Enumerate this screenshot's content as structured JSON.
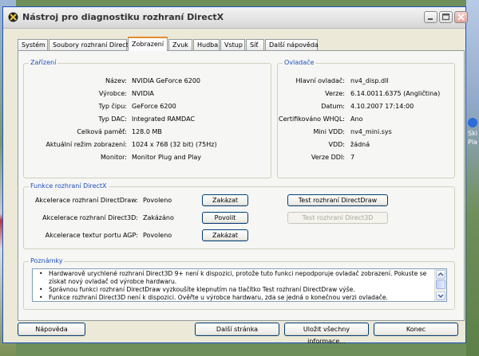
{
  "window": {
    "title": "Nástroj pro diagnostiku rozhraní DirectX"
  },
  "tabs": [
    {
      "label": "Systém"
    },
    {
      "label": "Soubory rozhraní DirectX"
    },
    {
      "label": "Zobrazení"
    },
    {
      "label": "Zvuk"
    },
    {
      "label": "Hudba"
    },
    {
      "label": "Vstup"
    },
    {
      "label": "Síť"
    },
    {
      "label": "Další nápověda"
    }
  ],
  "active_tab": "Zobrazení",
  "device": {
    "title": "Zařízení",
    "rows": [
      {
        "label": "Název:",
        "value": "NVIDIA GeForce 6200"
      },
      {
        "label": "Výrobce:",
        "value": "NVIDIA"
      },
      {
        "label": "Typ čipu:",
        "value": "GeForce 6200"
      },
      {
        "label": "Typ DAC:",
        "value": "Integrated RAMDAC"
      },
      {
        "label": "Celková paměť:",
        "value": "128.0 MB"
      },
      {
        "label": "Aktuální režim zobrazení:",
        "value": "1024 x 768 (32 bit) (75Hz)"
      },
      {
        "label": "Monitor:",
        "value": "Monitor Plug and Play"
      }
    ]
  },
  "drivers": {
    "title": "Ovladače",
    "rows": [
      {
        "label": "Hlavní ovladač:",
        "value": "nv4_disp.dll"
      },
      {
        "label": "Verze:",
        "value": "6.14.0011.6375 (Angličtina)"
      },
      {
        "label": "Datum:",
        "value": "4.10.2007 17:14:00"
      },
      {
        "label": "Certifikováno WHQL:",
        "value": "Ano"
      },
      {
        "label": "Mini VDD:",
        "value": "nv4_mini.sys"
      },
      {
        "label": "VDD:",
        "value": "žádná"
      },
      {
        "label": "Verze DDI:",
        "value": "7"
      }
    ]
  },
  "features": {
    "title": "Funkce rozhraní DirectX",
    "rows": [
      {
        "label": "Akcelerace rozhraní DirectDraw:",
        "status": "Povoleno",
        "toggle": "Zakázat",
        "test": "Test rozhraní DirectDraw",
        "test_enabled": true
      },
      {
        "label": "Akcelerace rozhraní Direct3D:",
        "status": "Zakázáno",
        "toggle": "Povolit",
        "test": "Test rozhraní Direct3D",
        "test_enabled": false
      },
      {
        "label": "Akcelerace textur portu AGP:",
        "status": "Povoleno",
        "toggle": "Zakázat"
      }
    ]
  },
  "notes": {
    "title": "Poznámky",
    "items": [
      "Hardwarově urychlené rozhraní Direct3D 9+ není k dispozici, protože tuto funkci nepodporuje ovladač zobrazení. Pokuste se získat nový ovladač od výrobce hardwaru.",
      "Správnou funkci rozhraní DirectDraw vyzkoušíte klepnutím na tlačítko Test rozhraní DirectDraw výše.",
      "Funkce rozhraní Direct3D není k dispozici. Ověřte u výrobce hardwaru, zda se jedná o konečnou verzi ovladače."
    ]
  },
  "footer": {
    "help": "Nápověda",
    "next_page": "Další stránka",
    "save_all": "Uložit všechny informace...",
    "exit": "Konec"
  },
  "desktop": {
    "right_text": "Ski\nPla"
  }
}
